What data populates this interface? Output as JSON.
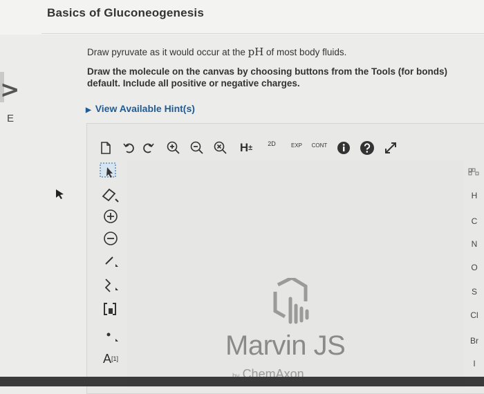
{
  "page": {
    "title": "Basics of Gluconeogenesis",
    "side_letter": "E"
  },
  "question": {
    "line1_pre": "Draw pyruvate as it would occur at the ",
    "line1_ph": "pH",
    "line1_post": " of most body fluids.",
    "line2a": "Draw the molecule on the canvas by choosing buttons from the Tools (for bonds)",
    "line2b": "default. Include all positive or negative charges.",
    "hint_label": "View Available Hint(s)"
  },
  "toolbar": {
    "h_label": "H",
    "h_sup": "±",
    "twod_label": "2D",
    "exp_label": "EXP",
    "cont_label": "CONT"
  },
  "side_tools": {
    "atom_label": "A",
    "atom_sup": "[1]"
  },
  "periodic": [
    "H",
    "C",
    "N",
    "O",
    "S",
    "Cl",
    "Br",
    "I"
  ],
  "branding": {
    "product": "Marvin JS",
    "by": "by",
    "company": "ChemAxon"
  },
  "colors": {
    "link": "#1f5b95",
    "logo": "#8a8a88"
  }
}
